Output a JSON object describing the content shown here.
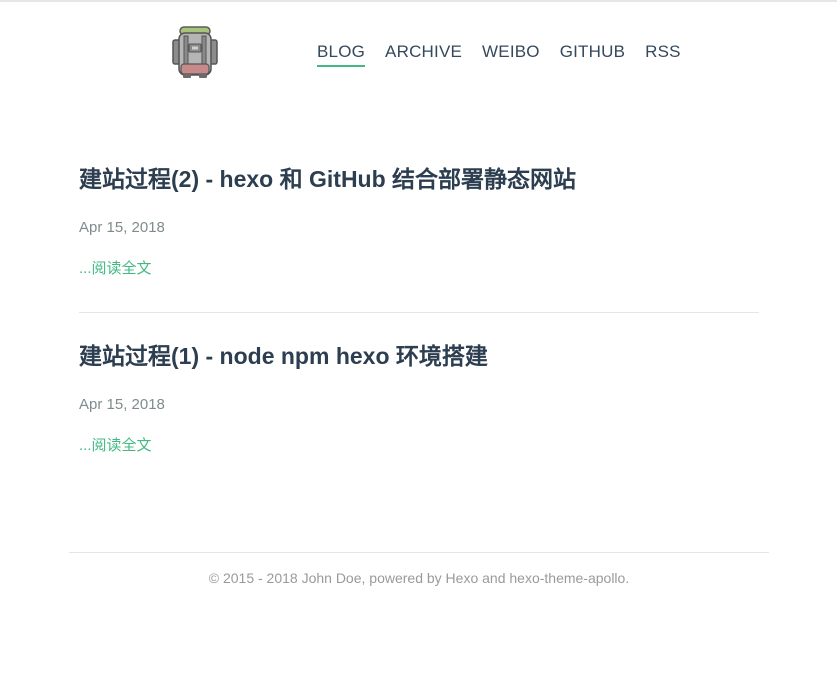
{
  "header": {
    "logo_icon": "backpack-icon",
    "nav": [
      {
        "label": "BLOG",
        "active": true
      },
      {
        "label": "ARCHIVE",
        "active": false
      },
      {
        "label": "WEIBO",
        "active": false
      },
      {
        "label": "GITHUB",
        "active": false
      },
      {
        "label": "RSS",
        "active": false
      }
    ]
  },
  "posts": [
    {
      "title": "建站过程(2) - hexo 和 GitHub 结合部署静态网站",
      "date": "Apr 15, 2018",
      "more": "...阅读全文"
    },
    {
      "title": "建站过程(1) - node npm hexo 环境搭建",
      "date": "Apr 15, 2018",
      "more": "...阅读全文"
    }
  ],
  "footer": {
    "text": "© 2015 - 2018 John Doe, powered by Hexo and hexo-theme-apollo."
  },
  "colors": {
    "accent": "#42b983",
    "title": "#2c3e50",
    "muted": "#7f8c8d",
    "footer_text": "#9a9a9a"
  }
}
